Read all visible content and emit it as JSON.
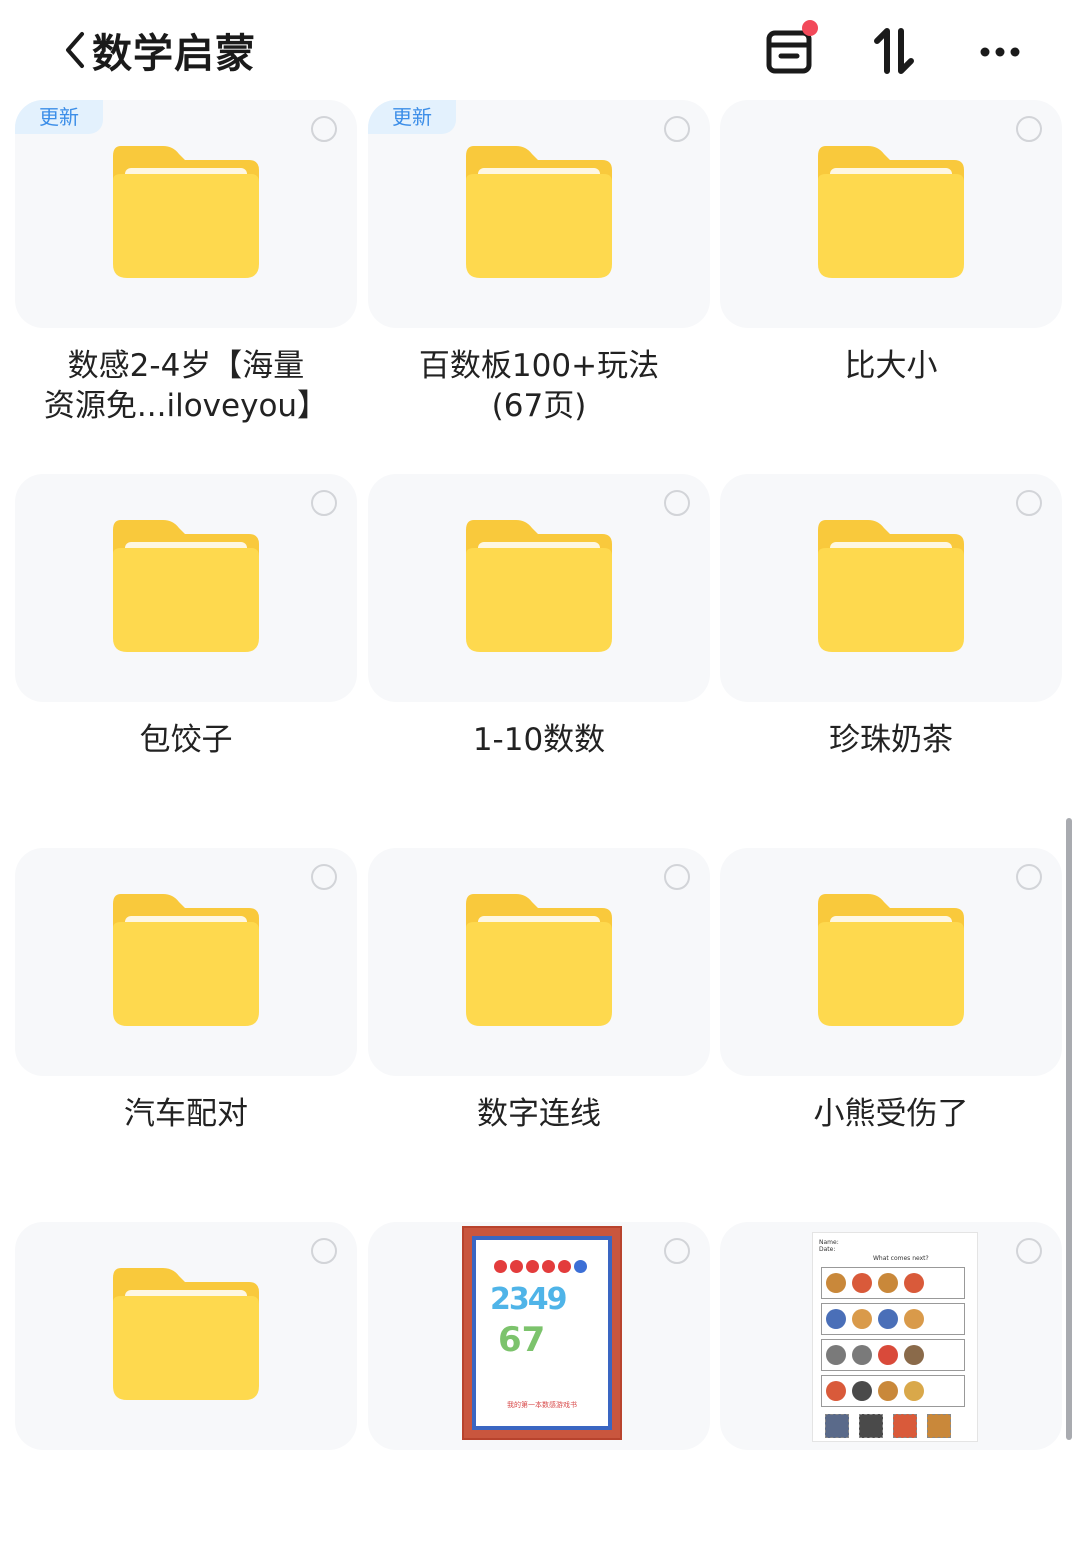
{
  "header": {
    "title": "数学启蒙",
    "icons": [
      "chevron-left-icon",
      "card-box-icon",
      "sort-icon",
      "more-icon"
    ],
    "badge_color": "#f2495a"
  },
  "items": [
    {
      "name_line1": "数感2-4岁【海量",
      "name_line2": "资源免...iloveyou】",
      "badge": "更新",
      "kind": "folder"
    },
    {
      "name_line1": "百数板100+玩法",
      "name_line2": "(67页)",
      "badge": "更新",
      "kind": "folder"
    },
    {
      "name_line1": "比大小",
      "name_line2": "",
      "badge": "",
      "kind": "folder"
    },
    {
      "name_line1": "包饺子",
      "name_line2": "",
      "badge": "",
      "kind": "folder"
    },
    {
      "name_line1": "1-10数数",
      "name_line2": "",
      "badge": "",
      "kind": "folder"
    },
    {
      "name_line1": "珍珠奶茶",
      "name_line2": "",
      "badge": "",
      "kind": "folder"
    },
    {
      "name_line1": "汽车配对",
      "name_line2": "",
      "badge": "",
      "kind": "folder"
    },
    {
      "name_line1": "数字连线",
      "name_line2": "",
      "badge": "",
      "kind": "folder"
    },
    {
      "name_line1": "小熊受伤了",
      "name_line2": "",
      "badge": "",
      "kind": "folder"
    },
    {
      "name_line1": "",
      "name_line2": "",
      "badge": "",
      "kind": "folder"
    },
    {
      "name_line1": "",
      "name_line2": "",
      "badge": "",
      "kind": "document-thumbnail"
    },
    {
      "name_line1": "",
      "name_line2": "",
      "badge": "",
      "kind": "worksheet-thumbnail"
    }
  ],
  "thumbnails": {
    "numbers_cover": {
      "digits_line1": "2349",
      "digits_line2": "67",
      "caption": "我的第一本数感游戏书"
    },
    "worksheet": {
      "label_name": "Name:",
      "label_date": "Date:",
      "heading": "What comes next?"
    }
  },
  "colors": {
    "folder_top": "#fdd24c",
    "folder_body": "#fed94e",
    "badge_text": "#3c8ee8",
    "badge_bg": "#e3f1fd",
    "card_bg": "#f7f8fa"
  }
}
